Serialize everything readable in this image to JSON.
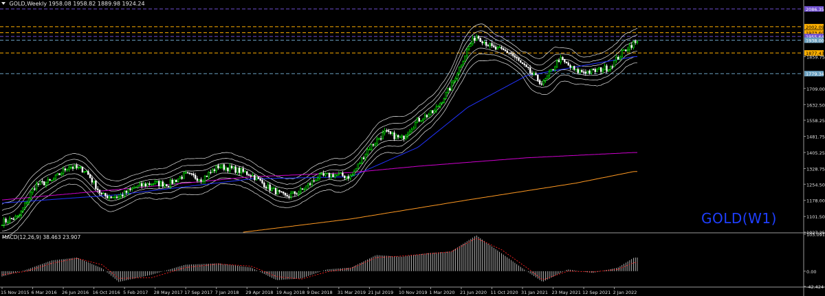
{
  "header": {
    "symbol": "GOLD,Weekly",
    "ohlc": "1958.08 1958.82 1889.98 1924.24"
  },
  "watermark": "GOLD(W1)",
  "macd_header": "MACD(12,26,9) 38.463 23.907",
  "colors": {
    "background": "#000000",
    "bull_candle": "#00ff00",
    "bear_candle": "#ffffff",
    "bands": "#ffffff",
    "ma_blue": "#2233ff",
    "ma_magenta": "#d000d0",
    "ma_orange": "#ff9922",
    "level_orange": "#ffb000",
    "level_purple": "#7050d0",
    "level_blue": "#6aa0c0",
    "watermark": "#1f3fff"
  },
  "chart_data": [
    {
      "type": "candlestick",
      "title": "GOLD,Weekly",
      "y_ticks": [
        2086.35,
        2002.09,
        1973.6,
        1955.64,
        1938.0,
        1877.43,
        1859.75,
        1779.34,
        1709.0,
        1632.5,
        1558.25,
        1481.75,
        1405.25,
        1328.75,
        1254.5,
        1178.0,
        1101.5,
        1027.25
      ],
      "ylim": [
        1027.25,
        2086.35
      ],
      "x_tick_labels": [
        "15 Nov 2015",
        "6 Mar 2016",
        "26 Jun 2016",
        "16 Oct 2016",
        "5 Feb 2017",
        "28 May 2017",
        "17 Sep 2017",
        "7 Jan 2018",
        "29 Apr 2018",
        "19 Aug 2018",
        "9 Dec 2018",
        "31 Mar 2019",
        "21 Jul 2019",
        "10 Nov 2019",
        "1 Mar 2020",
        "21 Jun 2020",
        "11 Oct 2020",
        "31 Jan 2021",
        "23 May 2021",
        "12 Sep 2021",
        "2 Jan 2022"
      ],
      "horizontal_levels": [
        {
          "value": 2086.35,
          "label": "2086.35",
          "color": "#7050d0",
          "style": "dashed"
        },
        {
          "value": 2002.09,
          "label": "2002.09",
          "color": "#ffb000",
          "style": "dashed"
        },
        {
          "value": 1973.6,
          "label": "1973.60",
          "color": "#ffb000",
          "style": "dashed"
        },
        {
          "value": 1955.64,
          "label": "1955.64",
          "color": "#7050d0",
          "style": "dashed"
        },
        {
          "value": 1938.0,
          "label": "1938.00",
          "color": "#6aa0c0",
          "style": "dashed"
        },
        {
          "value": 1877.43,
          "label": "1877.43",
          "color": "#ffb000",
          "style": "dashed"
        },
        {
          "value": 1779.34,
          "label": "1779.34",
          "color": "#6aa0c0",
          "style": "dashed"
        }
      ],
      "series": [
        {
          "kind": "price_close",
          "x": [
            "2015-11",
            "2016-01",
            "2016-03",
            "2016-05",
            "2016-07",
            "2016-09",
            "2016-11",
            "2017-01",
            "2017-03",
            "2017-05",
            "2017-07",
            "2017-09",
            "2017-11",
            "2018-01",
            "2018-03",
            "2018-05",
            "2018-07",
            "2018-09",
            "2018-11",
            "2019-01",
            "2019-03",
            "2019-05",
            "2019-07",
            "2019-09",
            "2019-11",
            "2020-01",
            "2020-03",
            "2020-05",
            "2020-07",
            "2020-08",
            "2020-10",
            "2020-12",
            "2021-02",
            "2021-04",
            "2021-06",
            "2021-08",
            "2021-10",
            "2021-12",
            "2022-02",
            "2022-03"
          ],
          "values": [
            1075,
            1100,
            1250,
            1270,
            1340,
            1320,
            1200,
            1195,
            1240,
            1260,
            1255,
            1300,
            1280,
            1340,
            1325,
            1300,
            1240,
            1195,
            1225,
            1290,
            1300,
            1290,
            1420,
            1500,
            1470,
            1560,
            1600,
            1720,
            1900,
            1960,
            1900,
            1880,
            1800,
            1730,
            1850,
            1790,
            1790,
            1810,
            1900,
            1924
          ]
        }
      ],
      "moving_averages": [
        {
          "color": "#2233ff",
          "x": [
            "2015-11",
            "2017-01",
            "2018-05",
            "2019-05",
            "2020-01",
            "2020-07",
            "2021-02",
            "2022-03"
          ],
          "values": [
            1165,
            1205,
            1280,
            1290,
            1430,
            1620,
            1770,
            1860
          ]
        },
        {
          "color": "#d000d0",
          "x": [
            "2015-11",
            "2017-01",
            "2018-05",
            "2019-05",
            "2020-01",
            "2021-02",
            "2022-03"
          ],
          "values": [
            1180,
            1230,
            1290,
            1310,
            1340,
            1380,
            1405
          ]
        },
        {
          "color": "#ff9922",
          "x": [
            "2018-04",
            "2019-05",
            "2020-07",
            "2021-08",
            "2022-03"
          ],
          "values": [
            1027,
            1090,
            1180,
            1260,
            1315
          ]
        }
      ]
    },
    {
      "type": "bar",
      "title": "MACD(12,26,9) 38.463 23.907",
      "y_ticks": [
        103.091,
        0.0,
        -42.424
      ],
      "ylim": [
        -42.424,
        103.091
      ],
      "histogram": {
        "x": [
          "2015-11",
          "2016-02",
          "2016-05",
          "2016-08",
          "2016-11",
          "2017-01",
          "2017-05",
          "2017-09",
          "2018-01",
          "2018-05",
          "2018-08",
          "2018-11",
          "2019-02",
          "2019-05",
          "2019-08",
          "2019-11",
          "2020-02",
          "2020-05",
          "2020-08",
          "2020-11",
          "2021-02",
          "2021-04",
          "2021-07",
          "2021-10",
          "2022-01",
          "2022-03"
        ],
        "values": [
          -15,
          5,
          30,
          38,
          8,
          -30,
          -10,
          18,
          22,
          10,
          -25,
          -20,
          5,
          10,
          45,
          40,
          50,
          55,
          100,
          50,
          0,
          -30,
          5,
          -5,
          10,
          38
        ]
      },
      "signal": {
        "color": "#ff2222",
        "values": [
          -10,
          0,
          22,
          36,
          18,
          -20,
          -18,
          10,
          20,
          14,
          -15,
          -22,
          -2,
          8,
          38,
          42,
          48,
          54,
          92,
          60,
          10,
          -24,
          0,
          -2,
          5,
          24
        ]
      }
    }
  ]
}
